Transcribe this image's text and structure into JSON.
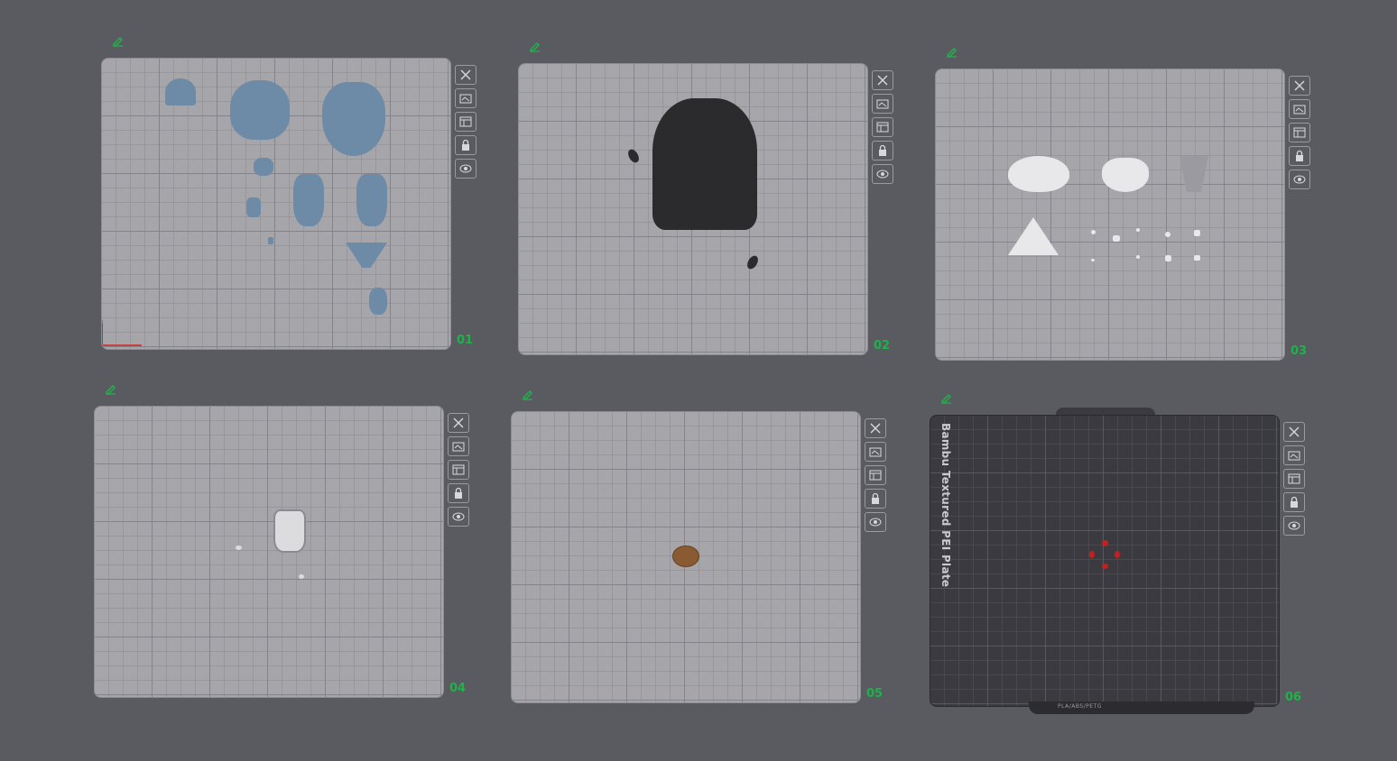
{
  "plates": [
    {
      "id": "p1",
      "number": "01",
      "dark": false,
      "name": ""
    },
    {
      "id": "p2",
      "number": "02",
      "dark": false,
      "name": ""
    },
    {
      "id": "p3",
      "number": "03",
      "dark": false,
      "name": ""
    },
    {
      "id": "p4",
      "number": "04",
      "dark": false,
      "name": ""
    },
    {
      "id": "p5",
      "number": "05",
      "dark": false,
      "name": ""
    },
    {
      "id": "p6",
      "number": "06",
      "dark": true,
      "name": "Bambu Textured PEI Plate",
      "foot_label": "PLA/ABS/PETG"
    }
  ],
  "toolbar_icons": [
    "close-icon",
    "auto-orient-icon",
    "arrange-icon",
    "lock-icon",
    "eye-icon"
  ],
  "edit_icon": "pencil-icon",
  "colors": {
    "background": "#5a5a61",
    "plate_light": "#a5a5aa",
    "plate_dark": "#3a3a3f",
    "number_green": "#1fb24a",
    "model_blue": "#6d8aa6",
    "model_black": "#2b2b2d",
    "model_white": "#e8e8ea",
    "model_brown": "#8a5a33",
    "model_red": "#c42020"
  }
}
